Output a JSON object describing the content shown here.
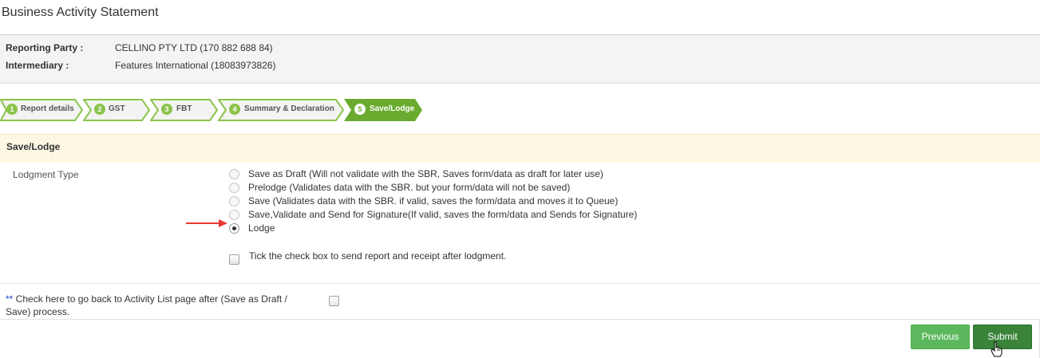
{
  "page": {
    "title": "Business Activity Statement"
  },
  "party": {
    "reporting_label": "Reporting Party :",
    "reporting_value": "CELLINO PTY LTD (170 882 688 84)",
    "intermediary_label": "Intermediary :",
    "intermediary_value": "Features International (18083973826)"
  },
  "steps": [
    {
      "num": "1",
      "label": "Report details"
    },
    {
      "num": "2",
      "label": "GST"
    },
    {
      "num": "3",
      "label": "FBT"
    },
    {
      "num": "4",
      "label": "Summary & Declaration"
    },
    {
      "num": "5",
      "label": "Save/Lodge",
      "active": true
    }
  ],
  "section": {
    "title": "Save/Lodge"
  },
  "lodgment": {
    "label": "Lodgment Type",
    "options": [
      {
        "label": "Save as Draft (Will not validate with the SBR, Saves form/data as draft for later use)",
        "checked": false
      },
      {
        "label": "Prelodge (Validates data with the SBR. but your form/data will not be saved)",
        "checked": false
      },
      {
        "label": "Save (Validates data with the SBR. if valid, saves the form/data and moves it to Queue)",
        "checked": false
      },
      {
        "label": "Save,Validate and Send for Signature(If valid, saves the form/data and Sends for Signature)",
        "checked": false
      },
      {
        "label": "Lodge",
        "checked": true
      }
    ],
    "send_receipt_label": "Tick the check box to send report and receipt after lodgment."
  },
  "back_option": {
    "stars": "**",
    "text": " Check here to go back to Activity List page after (Save as Draft / Save) process."
  },
  "buttons": {
    "previous": "Previous",
    "submit": "Submit"
  },
  "colors": {
    "step_green": "#8bc34a",
    "step_active": "#6aab2f",
    "button_green": "#5cb85c",
    "button_dark_green": "#398439",
    "arrow_red": "#e53935",
    "section_bg": "#fdf7e4"
  }
}
